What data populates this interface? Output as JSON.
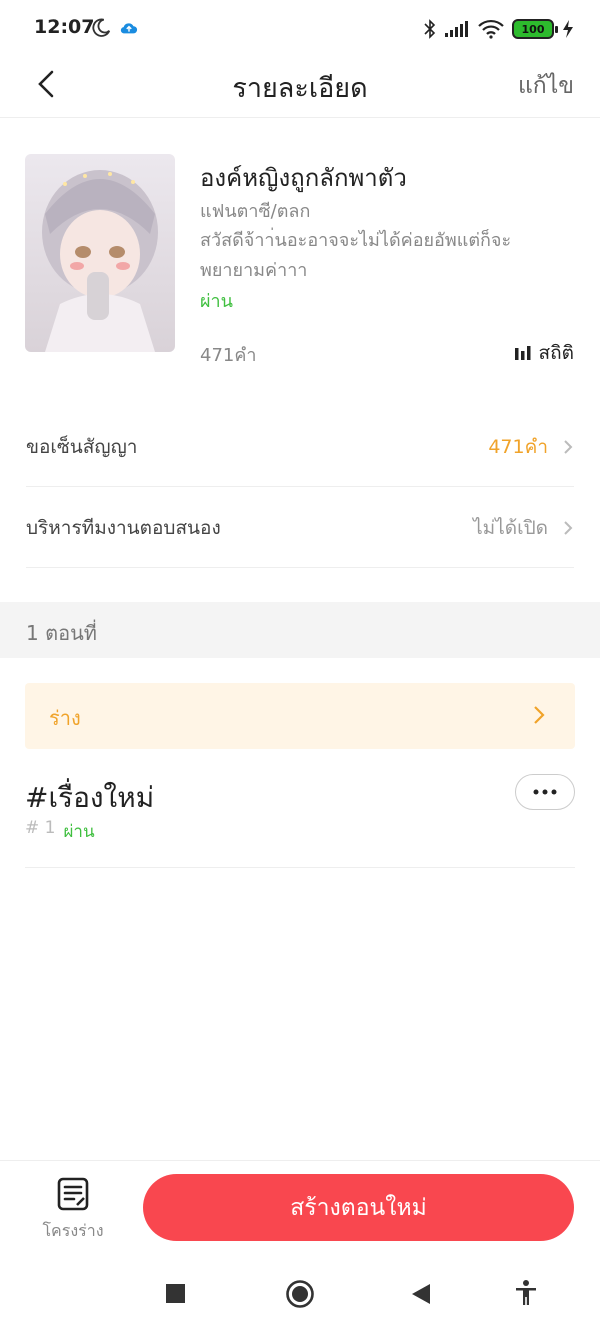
{
  "status_bar": {
    "time": "12:07",
    "battery": "100",
    "icons": [
      "moon-icon",
      "cloud-upload-icon",
      "bluetooth-icon",
      "signal-icon",
      "wifi-icon",
      "battery-icon",
      "charging-icon"
    ]
  },
  "navbar": {
    "title": "รายละเอียด",
    "edit_label": "แก้ไข"
  },
  "book": {
    "title": "องค์หญิงถูกลักพาตัว",
    "genre": "แฟนตาซี/ตลก",
    "description": "สวัสดีจ้าา่นอะอาจจะไม่ได้ค่อยอัพแต่ก็จะพยายามค่าาา",
    "status": "ผ่าน",
    "word_count": "471คำ",
    "stats_label": "สถิติ"
  },
  "rows": {
    "contract_label": "ขอเซ็นสัญญา",
    "contract_value": "471คำ",
    "team_label": "บริหารทีมงานตอบสนอง",
    "team_value": "ไม่ได้เปิด"
  },
  "chapters": {
    "section_label": "1 ตอนที่",
    "draft_label": "ร่าง",
    "items": [
      {
        "title": "#เรื่องใหม่",
        "number": "# 1",
        "status": "ผ่าน"
      }
    ]
  },
  "bottom": {
    "outline_label": "โครงร่าง",
    "create_label": "สร้างตอนใหม่"
  },
  "colors": {
    "accent_red": "#f9474f",
    "accent_orange": "#f0a32a",
    "status_green": "#3fbf3f"
  }
}
